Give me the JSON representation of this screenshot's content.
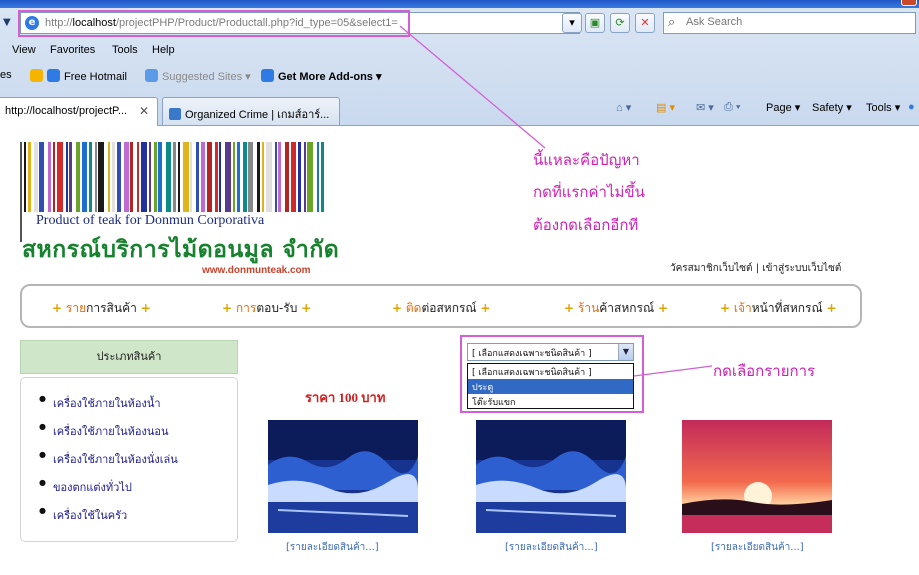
{
  "browser": {
    "url_path_gray": "http://",
    "url_host": "localhost",
    "url_rest": "/projectPHP/Product/Productall.php?id_type=05&select1=",
    "search_placeholder": "Ask Search",
    "menu": [
      "View",
      "Favorites",
      "Tools",
      "Help"
    ],
    "favorites": [
      {
        "label": "Free Hotmail",
        "color": "#2f7be3"
      },
      {
        "label": "Suggested Sites ▾",
        "color": "#2f7be3"
      },
      {
        "label": "Get More Add-ons ▾",
        "color": "#2f7be3"
      }
    ],
    "favorites_prefix": "es",
    "tabs": [
      {
        "label": "http://localhost/projectP...",
        "close": "✕"
      },
      {
        "label": "Organized Crime  |  เกมส์อาร์..."
      }
    ],
    "command_bar": {
      "page": "Page ▾",
      "safety": "Safety ▾",
      "tools": "Tools ▾"
    }
  },
  "site": {
    "logo_en": "Product of teak for Donmun Corporativa",
    "logo_th": "สหกรณ์บริการไม้ดอนมูล จำกัด",
    "logo_url": "www.donmunteak.com",
    "account_links": "วัครสมาชิกเว็บไซต์ | เข้าสู่ระบบเว็บไซต์",
    "nav": [
      {
        "hl": "ราย",
        "rest": "การสินค้า"
      },
      {
        "hl": "การ",
        "rest": "ตอบ-รับ"
      },
      {
        "hl": "ติด",
        "rest": "ต่อสหกรณ์"
      },
      {
        "hl": "ร้าน",
        "rest": "ค้าสหกรณ์"
      },
      {
        "hl": "เจ้า",
        "rest": "หน้าที่สหกรณ์"
      }
    ],
    "nav_plus": "+",
    "category_title": "ประเภทสินค้า",
    "categories": [
      "เครื่องใช้ภายในห้องน้ำ",
      "เครื่องใช้ภายในห้องนอน",
      "เครื่องใช้ภายในห้องนั่งเล่น",
      "ของตกแต่งทั่วไป",
      "เครื่องใช้ในครัว"
    ],
    "select_value": "[ เลือกแสดงเฉพาะชนิดสินค้า ]",
    "select_options": [
      "[ เลือกแสดงเฉพาะชนิดสินค้า ]",
      "ประตู",
      "โต๊ะรับแขก"
    ],
    "price": "ราคา 100 บาท",
    "detail_link": "[รายละเอียดสินค้า...]"
  },
  "annotations": {
    "line1": "นี้แหละคือปัญหา",
    "line2": "กดที่แรกค่าไม่ขึ้น",
    "line3": "ต้องกดเลือกอีกที",
    "select_note": "กดเลือกรายการ",
    "color": "#cf1fb5"
  }
}
